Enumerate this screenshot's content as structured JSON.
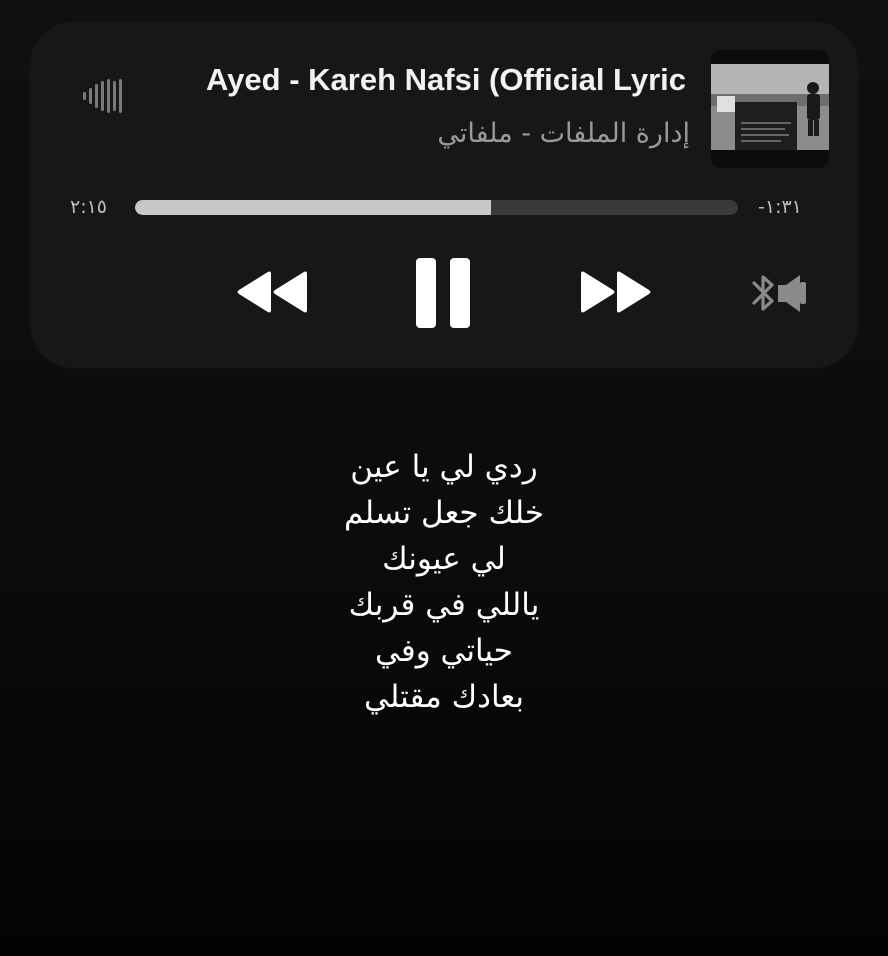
{
  "player": {
    "title": "Ayed - Kareh Nafsi (Official Lyric",
    "subtitle": "إدارة الملفات - ملفاتي",
    "artwork_icon": "album-artwork",
    "waveform_icon": "waveform-icon",
    "time_elapsed": "٢:١٥",
    "time_remaining": "-١:٣١",
    "progress": 0.59,
    "controls": {
      "rewind_icon": "rewind-icon",
      "pause_icon": "pause-icon",
      "forward_icon": "fast-forward-icon",
      "output_icon": "bluetooth-speaker-icon"
    },
    "artwork_text": "كاره نفسي"
  },
  "lyrics": [
    "ردي لي يا عين",
    "خلك جعل تسلم",
    "لي عيونك",
    "ياللي في قربك",
    "حياتي وفي",
    "بعادك مقتلي"
  ],
  "colors": {
    "background": "#0c0c0c",
    "card": "#171717",
    "progress_fill": "#c8c8c8",
    "progress_track": "#3a3a3a",
    "text_primary": "#f2f2f2",
    "text_secondary": "#9a9a9a"
  }
}
